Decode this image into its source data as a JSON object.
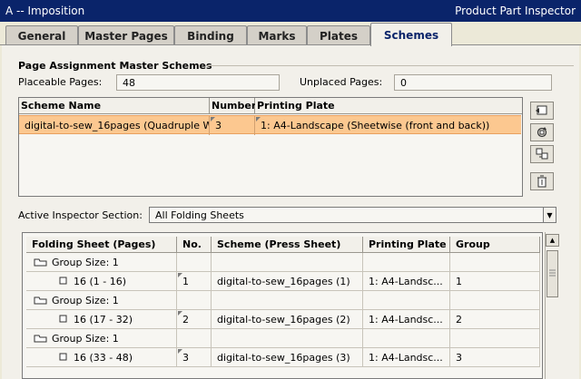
{
  "window": {
    "title": "A -- Imposition",
    "inspector_title": "Product Part Inspector"
  },
  "tabs": [
    {
      "label": "General"
    },
    {
      "label": "Master Pages"
    },
    {
      "label": "Binding"
    },
    {
      "label": "Marks"
    },
    {
      "label": "Plates"
    },
    {
      "label": "Schemes",
      "active": true
    }
  ],
  "page_assignment": {
    "title": "Page Assignment",
    "subtitle": "Master Schemes",
    "placeable_label": "Placeable Pages:",
    "placeable_value": "48",
    "unplaced_label": "Unplaced Pages:",
    "unplaced_value": "0"
  },
  "scheme_table": {
    "headers": [
      "Scheme Name",
      "Number",
      "Printing Plate"
    ],
    "rows": [
      {
        "name": "digital-to-sew_16pages (Quadruple W",
        "number": "3",
        "plate": "1: A4-Landscape (Sheetwise (front and back))"
      }
    ]
  },
  "side_buttons": [
    "new-scheme-icon",
    "refresh-icon",
    "assign-icon",
    "delete-icon"
  ],
  "active_section": {
    "label": "Active Inspector Section:",
    "value": "All Folding Sheets"
  },
  "folding_table": {
    "headers": [
      "Folding Sheet (Pages)",
      "No.",
      "Scheme (Press Sheet)",
      "Printing Plate",
      "Group"
    ],
    "groups": [
      {
        "group_label": "Group Size: 1",
        "sheet": "16 (1 - 16)",
        "no": "1",
        "scheme": "digital-to-sew_16pages  (1)",
        "plate": "1: A4-Landsc...",
        "group": "1"
      },
      {
        "group_label": "Group Size: 1",
        "sheet": "16 (17 - 32)",
        "no": "2",
        "scheme": "digital-to-sew_16pages  (2)",
        "plate": "1: A4-Landsc...",
        "group": "2"
      },
      {
        "group_label": "Group Size: 1",
        "sheet": "16 (33 - 48)",
        "no": "3",
        "scheme": "digital-to-sew_16pages  (3)",
        "plate": "1: A4-Landsc...",
        "group": "3"
      }
    ]
  },
  "colors": {
    "titlebar": "#0a246a",
    "selection": "#fcc890",
    "panel": "#f2f0ea"
  }
}
